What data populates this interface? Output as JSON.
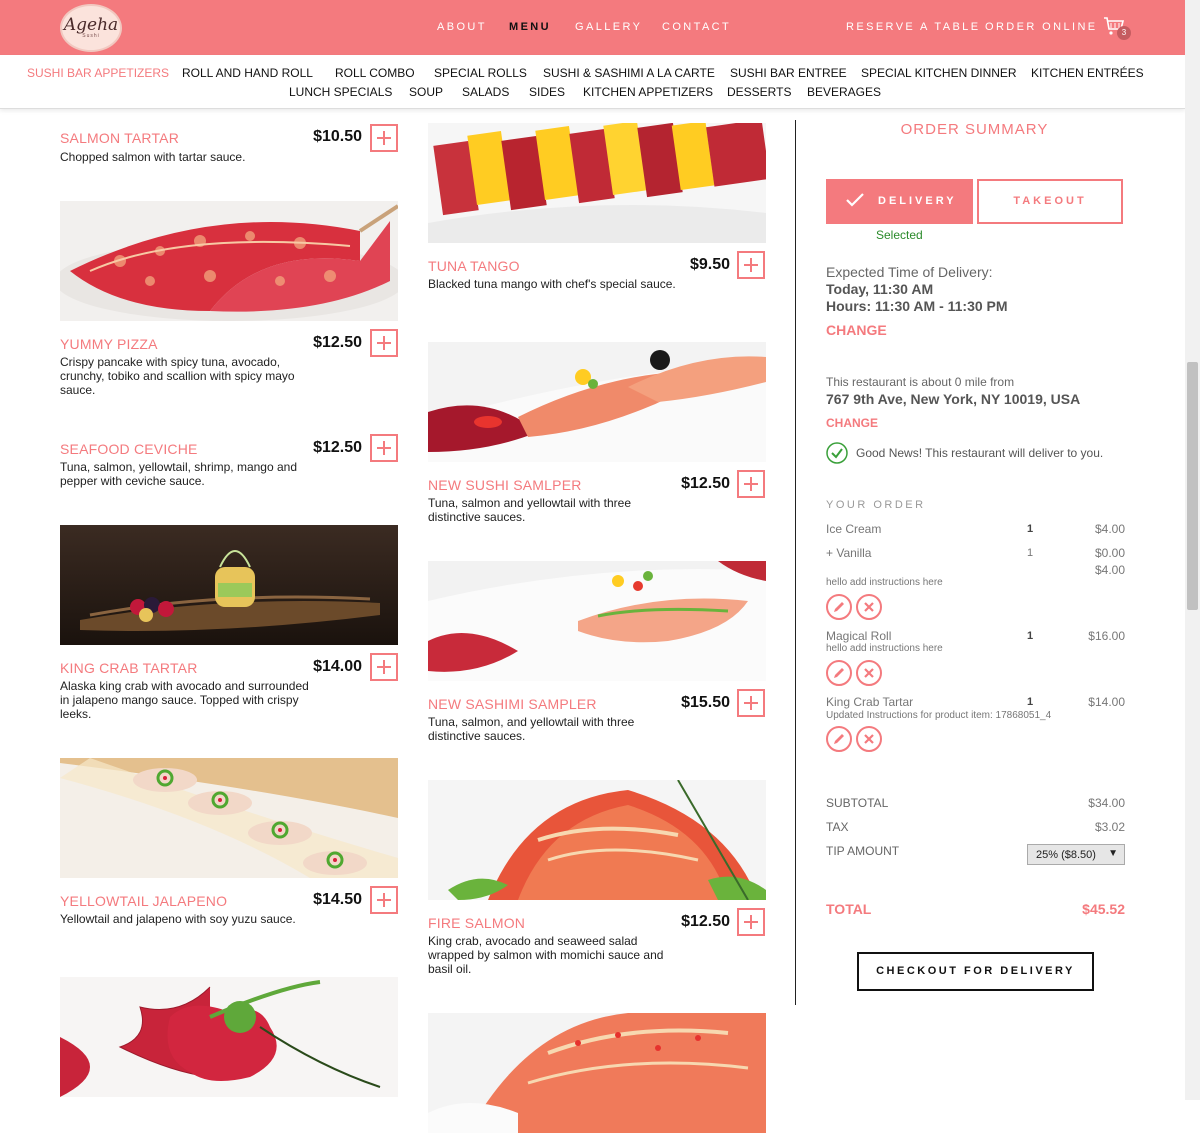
{
  "brand": {
    "logo_text": "Ageha",
    "logo_sub": "Sushi"
  },
  "nav": {
    "about": "ABOUT",
    "menu": "MENU",
    "gallery": "GALLERY",
    "contact": "CONTACT",
    "reserve": "RESERVE A TABLE",
    "order_online": "ORDER ONLINE",
    "cart_count": "3"
  },
  "categories": [
    "SUSHI BAR APPETIZERS",
    "ROLL AND HAND ROLL",
    "ROLL COMBO",
    "SPECIAL ROLLS",
    "SUSHI & SASHIMI A LA CARTE",
    "SUSHI BAR ENTREE",
    "SPECIAL KITCHEN DINNER",
    "KITCHEN ENTRÉES",
    "LUNCH SPECIALS",
    "SOUP",
    "SALADS",
    "SIDES",
    "KITCHEN APPETIZERS",
    "DESSERTS",
    "BEVERAGES"
  ],
  "items": {
    "salmon_tartar": {
      "name": "SALMON TARTAR",
      "price": "$10.50",
      "desc": "Chopped salmon with tartar sauce."
    },
    "yummy_pizza": {
      "name": "YUMMY PIZZA",
      "price": "$12.50",
      "desc": "Crispy pancake with spicy tuna, avocado, crunchy, tobiko and scallion with spicy mayo sauce."
    },
    "seafood_ceviche": {
      "name": "SEAFOOD CEVICHE",
      "price": "$12.50",
      "desc": "Tuna, salmon, yellowtail, shrimp, mango and pepper with ceviche sauce."
    },
    "king_crab_tartar": {
      "name": "KING CRAB TARTAR",
      "price": "$14.00",
      "desc": "Alaska king crab with avocado and surrounded in jalapeno mango sauce. Topped with crispy leeks."
    },
    "yellowtail_jalapeno": {
      "name": "YELLOWTAIL JALAPENO",
      "price": "$14.50",
      "desc": "Yellowtail and jalapeno with soy yuzu sauce."
    },
    "tuna_tango": {
      "name": "TUNA TANGO",
      "price": "$9.50",
      "desc": "Blacked tuna mango with chef's special sauce."
    },
    "new_sushi_sampler": {
      "name": "NEW SUSHI SAMLPER",
      "price": "$12.50",
      "desc": "Tuna, salmon and yellowtail with three distinctive sauces."
    },
    "new_sashimi_sampler": {
      "name": "NEW SASHIMI SAMPLER",
      "price": "$15.50",
      "desc": "Tuna, salmon, and yellowtail with three distinctive sauces."
    },
    "fire_salmon": {
      "name": "FIRE SALMON",
      "price": "$12.50",
      "desc": "King crab, avocado and seaweed salad wrapped by salmon with momichi sauce and basil oil."
    }
  },
  "order_summary": {
    "title": "ORDER SUMMARY",
    "delivery_label": "DELIVERY",
    "takeout_label": "TAKEOUT",
    "selected": "Selected",
    "expected_label": "Expected Time of Delivery:",
    "expected_time": "Today, 11:30 AM",
    "hours": "Hours: 11:30 AM - 11:30 PM",
    "change": "CHANGE",
    "distance_text": "This restaurant is about 0 mile from",
    "address": "767 9th Ave, New York, NY 10019, USA",
    "change2": "CHANGE",
    "good_news": "Good News! This restaurant will deliver to you.",
    "your_order": "YOUR ORDER",
    "lines": [
      {
        "name": "Ice Cream",
        "qty": "1",
        "price": "$4.00"
      },
      {
        "name": "+ Vanilla",
        "qty": "1",
        "price": "$0.00",
        "subtotal": "$4.00",
        "note": "hello add instructions here"
      },
      {
        "name": "Magical Roll",
        "qty": "1",
        "price": "$16.00",
        "note": "hello add instructions here"
      },
      {
        "name": "King Crab Tartar",
        "qty": "1",
        "price": "$14.00",
        "note": "Updated Instructions for product item: 17868051_4"
      }
    ],
    "subtotal_label": "SUBTOTAL",
    "subtotal": "$34.00",
    "tax_label": "TAX",
    "tax": "$3.02",
    "tip_label": "TIP AMOUNT",
    "tip_value": "25% ($8.50)",
    "total_label": "TOTAL",
    "total": "$45.52",
    "checkout": "CHECKOUT FOR DELIVERY"
  },
  "colors": {
    "brand": "#f47a7e",
    "success": "#2a8a2a"
  }
}
